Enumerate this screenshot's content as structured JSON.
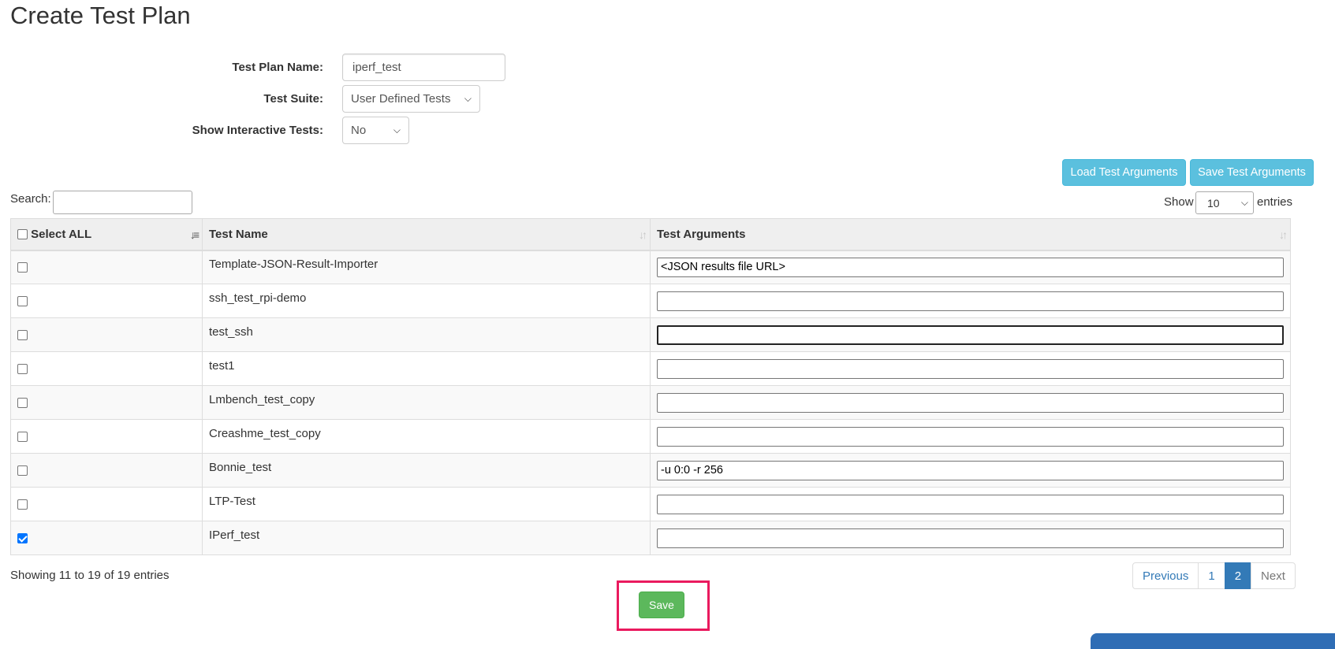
{
  "page": {
    "title": "Create Test Plan"
  },
  "form": {
    "plan_name_label": "Test Plan Name:",
    "plan_name_value": "iperf_test",
    "suite_label": "Test Suite:",
    "suite_value": "User Defined Tests",
    "interactive_label": "Show Interactive Tests:",
    "interactive_value": "No"
  },
  "toolbar": {
    "load_label": "Load Test Arguments",
    "save_label": "Save Test Arguments"
  },
  "table_controls": {
    "search_label": "Search:",
    "search_value": "",
    "show_label": "Show",
    "page_length": "10",
    "entries_label": "entries"
  },
  "table": {
    "headers": {
      "select_all": "Select ALL",
      "name": "Test Name",
      "args": "Test Arguments"
    },
    "rows": [
      {
        "checked": false,
        "name": "Template-JSON-Result-Importer",
        "args": "<JSON results file URL>"
      },
      {
        "checked": false,
        "name": "ssh_test_rpi-demo",
        "args": ""
      },
      {
        "checked": false,
        "name": "test_ssh",
        "args": ""
      },
      {
        "checked": false,
        "name": "test1",
        "args": ""
      },
      {
        "checked": false,
        "name": "Lmbench_test_copy",
        "args": ""
      },
      {
        "checked": false,
        "name": "Creashme_test_copy",
        "args": ""
      },
      {
        "checked": false,
        "name": "Bonnie_test",
        "args": "-u 0:0 -r 256"
      },
      {
        "checked": false,
        "name": "LTP-Test",
        "args": ""
      },
      {
        "checked": true,
        "name": "IPerf_test",
        "args": ""
      }
    ]
  },
  "info": {
    "text": "Showing 11 to 19 of 19 entries"
  },
  "pagination": {
    "previous": "Previous",
    "pages": [
      "1",
      "2"
    ],
    "active_page": "2",
    "next": "Next"
  },
  "actions": {
    "save_label": "Save"
  },
  "colors": {
    "accent": "#337ab7",
    "info_button": "#5bc0de",
    "save_button": "#5cb85c",
    "highlight": "#ea1a5e"
  }
}
